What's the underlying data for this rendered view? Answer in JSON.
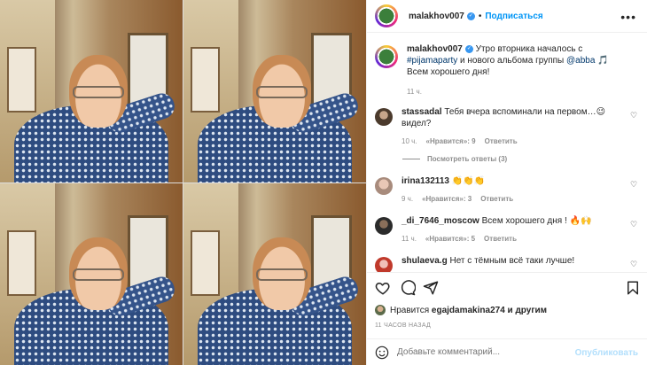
{
  "post": {
    "author": "malakhov007",
    "follow_label": "Подписаться",
    "caption": {
      "username": "malakhov007",
      "text_before": "Утро вторника началось с ",
      "hashtag": "#pijamaparty",
      "text_middle": " и нового альбома группы ",
      "mention": "@abba",
      "text_after": " 🎵",
      "line2": "Всем хорошего дня!",
      "time": "11 ч."
    },
    "comments": [
      {
        "username": "stassadal",
        "text": "Тебя вчера вспоминали на первом…😉 видел?",
        "time": "10 ч.",
        "likes": "«Нравится»: 9",
        "reply": "Ответить",
        "view_replies": "Посмотреть ответы (3)"
      },
      {
        "username": "irina132113",
        "text": "👏👏👏",
        "time": "9 ч.",
        "likes": "«Нравится»: 3",
        "reply": "Ответить"
      },
      {
        "username": "_di_7646_moscow",
        "text": "Всем хорошего дня ! 🔥🙌",
        "time": "11 ч.",
        "likes": "«Нравится»: 5",
        "reply": "Ответить"
      },
      {
        "username": "shulaeva.g",
        "text": "Нет с тёмным всё таки лучше!"
      }
    ],
    "liked_by": {
      "prefix": "Нравится",
      "user": "egajdamakina274",
      "suffix": "и другим"
    },
    "timestamp": "11 ЧАСОВ НАЗАД",
    "composer": {
      "placeholder": "Добавьте комментарий...",
      "publish": "Опубликовать"
    }
  },
  "icons": [
    "heart-icon",
    "comment-icon",
    "share-icon",
    "bookmark-icon",
    "emoji-icon",
    "more-icon",
    "verified-badge-icon"
  ],
  "colors": {
    "accent": "#0095f6",
    "publish_disabled": "#b2dffc",
    "muted": "#8e8e8e"
  }
}
